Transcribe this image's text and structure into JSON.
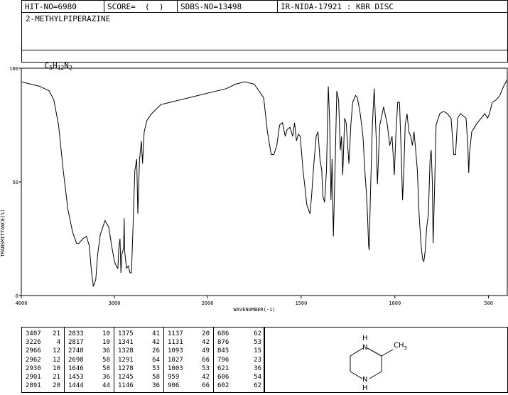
{
  "header": {
    "hit_no": "HIT-NO=6980",
    "score": "SCORE=  (  )",
    "sdbs_no": "SDBS-NO=13498",
    "ir_nida": "IR-NIDA-17921 : KBR DISC"
  },
  "compound": {
    "name": "2-METHYLPIPERAZINE",
    "formula_parts": [
      "C",
      "5",
      "H",
      "12",
      "N",
      "2"
    ]
  },
  "chart_data": {
    "type": "line",
    "title": "",
    "xlabel": "WAVENUMBER(-1)",
    "ylabel": "TRANSMITTANCE(%)",
    "xlim": [
      4000,
      400
    ],
    "ylim": [
      0,
      100
    ],
    "x_ticks": [
      4000,
      3000,
      2000,
      1500,
      1000,
      500
    ],
    "y_ticks": [
      0,
      50,
      100
    ],
    "grid": false,
    "legend": "none",
    "series": [
      {
        "color": "#000000",
        "points": [
          [
            4000,
            94
          ],
          [
            3900,
            93
          ],
          [
            3800,
            92
          ],
          [
            3700,
            90
          ],
          [
            3650,
            86
          ],
          [
            3600,
            75
          ],
          [
            3550,
            55
          ],
          [
            3500,
            38
          ],
          [
            3450,
            28
          ],
          [
            3407,
            23
          ],
          [
            3380,
            23
          ],
          [
            3340,
            25
          ],
          [
            3300,
            26
          ],
          [
            3270,
            22
          ],
          [
            3250,
            12
          ],
          [
            3226,
            4
          ],
          [
            3200,
            7
          ],
          [
            3180,
            18
          ],
          [
            3150,
            27
          ],
          [
            3100,
            33
          ],
          [
            3060,
            30
          ],
          [
            3030,
            22
          ],
          [
            3000,
            15
          ],
          [
            2980,
            13
          ],
          [
            2966,
            12
          ],
          [
            2962,
            12
          ],
          [
            2955,
            20
          ],
          [
            2940,
            25
          ],
          [
            2930,
            10
          ],
          [
            2920,
            18
          ],
          [
            2901,
            21
          ],
          [
            2895,
            34
          ],
          [
            2891,
            20
          ],
          [
            2870,
            12
          ],
          [
            2850,
            13
          ],
          [
            2833,
            10
          ],
          [
            2817,
            10
          ],
          [
            2800,
            30
          ],
          [
            2780,
            55
          ],
          [
            2760,
            60
          ],
          [
            2748,
            36
          ],
          [
            2730,
            60
          ],
          [
            2710,
            68
          ],
          [
            2698,
            58
          ],
          [
            2680,
            72
          ],
          [
            2650,
            77
          ],
          [
            2600,
            80
          ],
          [
            2500,
            84
          ],
          [
            2400,
            85
          ],
          [
            2300,
            86
          ],
          [
            2200,
            87
          ],
          [
            2100,
            88
          ],
          [
            2000,
            89
          ],
          [
            1900,
            91
          ],
          [
            1850,
            93
          ],
          [
            1800,
            94
          ],
          [
            1750,
            93
          ],
          [
            1700,
            87
          ],
          [
            1680,
            72
          ],
          [
            1660,
            62
          ],
          [
            1646,
            62
          ],
          [
            1630,
            66
          ],
          [
            1615,
            75
          ],
          [
            1600,
            76
          ],
          [
            1585,
            70
          ],
          [
            1575,
            73
          ],
          [
            1560,
            74
          ],
          [
            1545,
            70
          ],
          [
            1535,
            76
          ],
          [
            1525,
            68
          ],
          [
            1515,
            71
          ],
          [
            1505,
            70
          ],
          [
            1490,
            55
          ],
          [
            1480,
            48
          ],
          [
            1470,
            40
          ],
          [
            1453,
            36
          ],
          [
            1444,
            44
          ],
          [
            1435,
            55
          ],
          [
            1420,
            70
          ],
          [
            1410,
            72
          ],
          [
            1400,
            60
          ],
          [
            1390,
            55
          ],
          [
            1385,
            44
          ],
          [
            1375,
            41
          ],
          [
            1365,
            55
          ],
          [
            1355,
            92
          ],
          [
            1348,
            76
          ],
          [
            1341,
            42
          ],
          [
            1335,
            60
          ],
          [
            1328,
            26
          ],
          [
            1318,
            60
          ],
          [
            1310,
            90
          ],
          [
            1300,
            86
          ],
          [
            1291,
            64
          ],
          [
            1285,
            70
          ],
          [
            1278,
            53
          ],
          [
            1268,
            78
          ],
          [
            1260,
            76
          ],
          [
            1245,
            58
          ],
          [
            1235,
            75
          ],
          [
            1225,
            85
          ],
          [
            1210,
            88
          ],
          [
            1200,
            87
          ],
          [
            1185,
            80
          ],
          [
            1170,
            70
          ],
          [
            1160,
            55
          ],
          [
            1152,
            45
          ],
          [
            1146,
            36
          ],
          [
            1140,
            22
          ],
          [
            1137,
            20
          ],
          [
            1131,
            42
          ],
          [
            1120,
            75
          ],
          [
            1110,
            91
          ],
          [
            1100,
            70
          ],
          [
            1093,
            49
          ],
          [
            1080,
            75
          ],
          [
            1060,
            83
          ],
          [
            1040,
            75
          ],
          [
            1027,
            66
          ],
          [
            1015,
            70
          ],
          [
            1003,
            53
          ],
          [
            995,
            70
          ],
          [
            985,
            85
          ],
          [
            975,
            85
          ],
          [
            965,
            60
          ],
          [
            959,
            42
          ],
          [
            952,
            55
          ],
          [
            945,
            75
          ],
          [
            935,
            80
          ],
          [
            925,
            72
          ],
          [
            915,
            70
          ],
          [
            906,
            66
          ],
          [
            898,
            72
          ],
          [
            890,
            65
          ],
          [
            880,
            55
          ],
          [
            870,
            35
          ],
          [
            860,
            22
          ],
          [
            852,
            16
          ],
          [
            845,
            15
          ],
          [
            838,
            20
          ],
          [
            830,
            30
          ],
          [
            821,
            36
          ],
          [
            812,
            60
          ],
          [
            806,
            64
          ],
          [
            800,
            50
          ],
          [
            796,
            23
          ],
          [
            790,
            40
          ],
          [
            780,
            75
          ],
          [
            760,
            80
          ],
          [
            740,
            81
          ],
          [
            720,
            80
          ],
          [
            700,
            78
          ],
          [
            686,
            62
          ],
          [
            676,
            62
          ],
          [
            665,
            78
          ],
          [
            650,
            80
          ],
          [
            620,
            78
          ],
          [
            610,
            65
          ],
          [
            606,
            54
          ],
          [
            602,
            62
          ],
          [
            590,
            72
          ],
          [
            560,
            76
          ],
          [
            540,
            78
          ],
          [
            520,
            80
          ],
          [
            505,
            78
          ],
          [
            495,
            80
          ],
          [
            480,
            85
          ],
          [
            460,
            86
          ],
          [
            440,
            88
          ],
          [
            420,
            92
          ],
          [
            400,
            95
          ]
        ]
      }
    ]
  },
  "peaks": [
    [
      [
        "3407",
        "21"
      ],
      [
        "3226",
        "4"
      ],
      [
        "2966",
        "12"
      ],
      [
        "2962",
        "12"
      ],
      [
        "2930",
        "10"
      ],
      [
        "2901",
        "21"
      ],
      [
        "2891",
        "20"
      ]
    ],
    [
      [
        "2833",
        "10"
      ],
      [
        "2817",
        "10"
      ],
      [
        "2748",
        "36"
      ],
      [
        "2698",
        "58"
      ],
      [
        "1646",
        "58"
      ],
      [
        "1453",
        "36"
      ],
      [
        "1444",
        "44"
      ]
    ],
    [
      [
        "1375",
        "41"
      ],
      [
        "1341",
        "42"
      ],
      [
        "1328",
        "26"
      ],
      [
        "1291",
        "64"
      ],
      [
        "1278",
        "53"
      ],
      [
        "1245",
        "58"
      ],
      [
        "1146",
        "36"
      ]
    ],
    [
      [
        "1137",
        "20"
      ],
      [
        "1131",
        "42"
      ],
      [
        "1093",
        "49"
      ],
      [
        "1027",
        "66"
      ],
      [
        "1003",
        "53"
      ],
      [
        "959",
        "42"
      ],
      [
        "906",
        "66"
      ]
    ],
    [
      [
        "686",
        "62"
      ],
      [
        "876",
        "53"
      ],
      [
        "845",
        "15"
      ],
      [
        "796",
        "23"
      ],
      [
        "621",
        "36"
      ],
      [
        "606",
        "54"
      ],
      [
        "602",
        "62"
      ]
    ]
  ],
  "structure": {
    "atom_top": "H",
    "atom_bottom": "H",
    "atom_n1": "N",
    "atom_n2": "N",
    "substituent_main": "CH",
    "substituent_sub": "3"
  }
}
